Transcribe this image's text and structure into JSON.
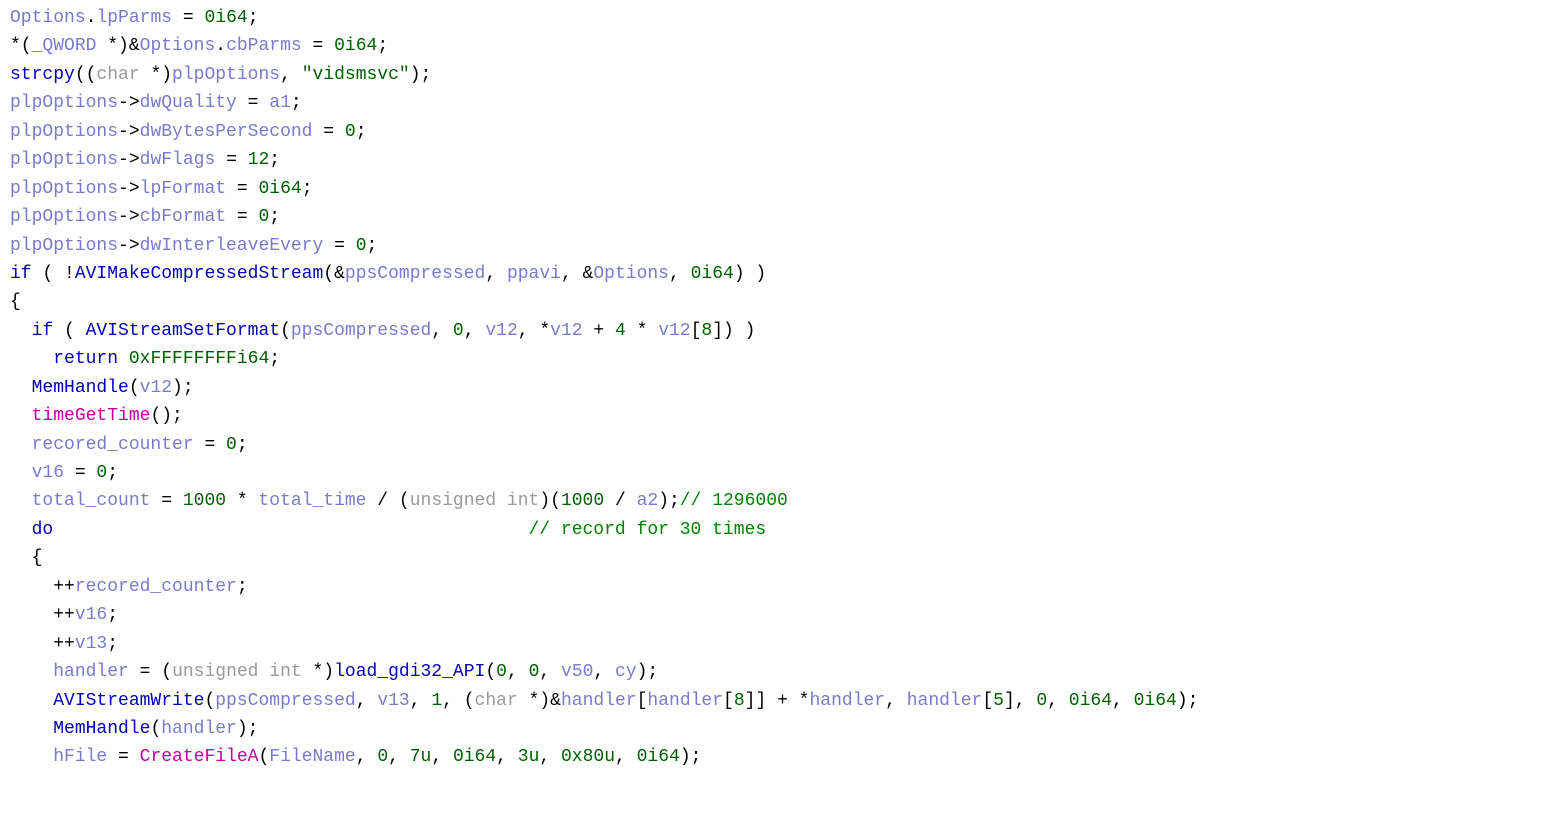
{
  "code": {
    "l1": {
      "a": "Options",
      "b": "lpParms",
      "c": "0i64"
    },
    "l2": {
      "a": "_QWORD",
      "b": "Options",
      "c": "cbParms",
      "d": "0i64"
    },
    "l3": {
      "a": "strcpy",
      "b": "char",
      "c": "plpOptions",
      "d": "\"vidsmsvc\""
    },
    "l4": {
      "a": "plpOptions",
      "b": "dwQuality",
      "c": "a1"
    },
    "l5": {
      "a": "plpOptions",
      "b": "dwBytesPerSecond",
      "c": "0"
    },
    "l6": {
      "a": "plpOptions",
      "b": "dwFlags",
      "c": "12"
    },
    "l7": {
      "a": "plpOptions",
      "b": "lpFormat",
      "c": "0i64"
    },
    "l8": {
      "a": "plpOptions",
      "b": "cbFormat",
      "c": "0"
    },
    "l9": {
      "a": "plpOptions",
      "b": "dwInterleaveEvery",
      "c": "0"
    },
    "l10": {
      "a": "if",
      "b": "AVIMakeCompressedStream",
      "c": "ppsCompressed",
      "d": "ppavi",
      "e": "Options",
      "f": "0i64"
    },
    "l12": {
      "a": "if",
      "b": "AVIStreamSetFormat",
      "c": "ppsCompressed",
      "d": "0",
      "e": "v12",
      "f": "v12",
      "g": "4",
      "h": "v12",
      "i": "8"
    },
    "l13": {
      "a": "return",
      "b": "0xFFFFFFFFi64"
    },
    "l14": {
      "a": "MemHandle",
      "b": "v12"
    },
    "l15": {
      "a": "timeGetTime"
    },
    "l16": {
      "a": "recored_counter",
      "b": "0"
    },
    "l17": {
      "a": "v16",
      "b": "0"
    },
    "l18": {
      "a": "total_count",
      "b": "1000",
      "c": "total_time",
      "d": "unsigned int",
      "e": "1000",
      "f": "a2",
      "g": "// 1296000"
    },
    "l19": {
      "a": "do",
      "b": "// record for 30 times"
    },
    "l21": {
      "a": "recored_counter"
    },
    "l22": {
      "a": "v16"
    },
    "l23": {
      "a": "v13"
    },
    "l24": {
      "a": "handler",
      "b": "unsigned int",
      "c": "load_gdi32_API",
      "d": "0",
      "e": "0",
      "f": "v50",
      "g": "cy"
    },
    "l25": {
      "a": "AVIStreamWrite",
      "b": "ppsCompressed",
      "c": "v13",
      "d": "1",
      "e": "char",
      "f": "handler",
      "g": "handler",
      "h": "8",
      "i": "handler",
      "j": "handler",
      "k": "5",
      "l": "0",
      "m": "0i64",
      "n": "0i64"
    },
    "l26": {
      "a": "MemHandle",
      "b": "handler"
    },
    "l27": {
      "a": "hFile",
      "b": "CreateFileA",
      "c": "FileName",
      "d": "0",
      "e": "7u",
      "f": "0i64",
      "g": "3u",
      "h": "0x80u",
      "i": "0i64"
    }
  }
}
